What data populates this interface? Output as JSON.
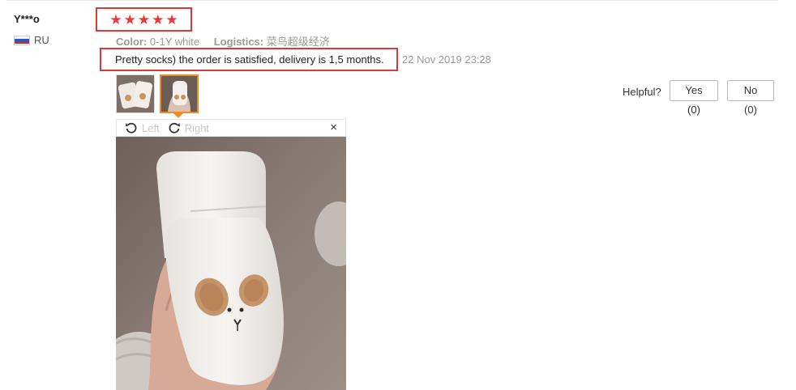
{
  "review": {
    "user": {
      "name": "Y***o",
      "country": "RU"
    },
    "rating": {
      "stars": 5,
      "max": 5,
      "glyph": "★"
    },
    "meta": {
      "color_key": "Color:",
      "color_value": "0-1Y white",
      "logistics_key": "Logistics:",
      "logistics_value": "菜鸟超级经济"
    },
    "text": "Pretty socks) the order is satisfied, delivery is 1,5 months.",
    "date": "22 Nov 2019 23:28",
    "helpful": {
      "label": "Helpful?",
      "yes": "Yes (0)",
      "no": "No (0)"
    }
  },
  "viewer": {
    "rotate_left": "Left",
    "rotate_right": "Right",
    "close": "×",
    "icons": [
      "rotate-left-icon",
      "rotate-right-icon",
      "close-icon"
    ]
  },
  "colors": {
    "star": "#e8393a",
    "highlight_box": "#d63b3b",
    "active_thumb": "#f08a24"
  }
}
